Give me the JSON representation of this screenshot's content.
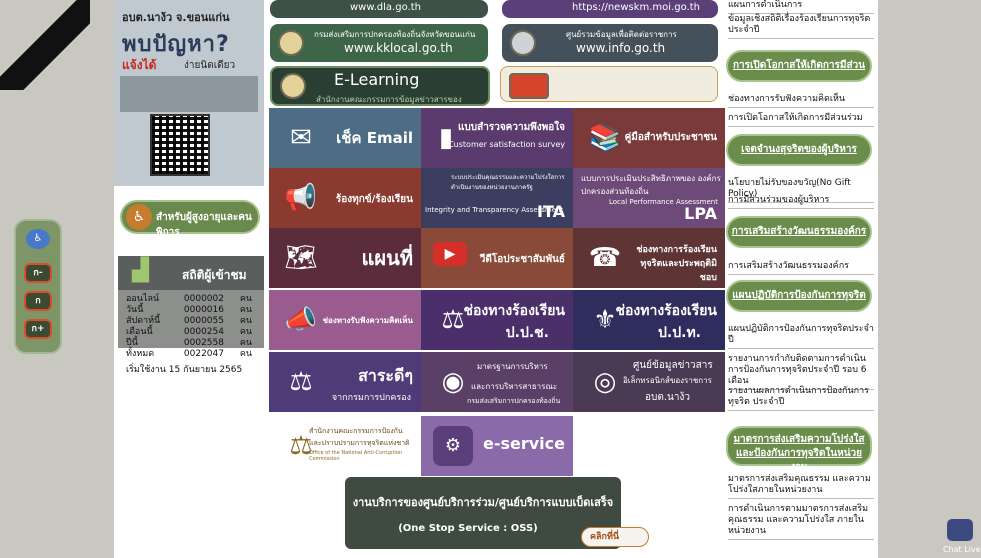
{
  "left_poster": {
    "org": "อบต.นาง้ว จ.ขอนแก่น",
    "headline": "พบปัญหา?",
    "sub_red": "แจ้งได้",
    "sub_dark": "ง่ายนิดเดียว"
  },
  "elderly_button": {
    "label": "สำหรับผู้สูงอายุและคนพิการ"
  },
  "stats": {
    "title": "สถิติผู้เข้าชม",
    "rows": [
      {
        "label": "ออนไลน์",
        "value": "0000002",
        "unit": "คน"
      },
      {
        "label": "วันนี้",
        "value": "0000016",
        "unit": "คน"
      },
      {
        "label": "สัปดาห์นี้",
        "value": "0000055",
        "unit": "คน"
      },
      {
        "label": "เดือนนี้",
        "value": "0000254",
        "unit": "คน"
      },
      {
        "label": "ปีนี้",
        "value": "0002558",
        "unit": "คน"
      },
      {
        "label": "ทั้งหมด",
        "value": "0022047",
        "unit": "คน"
      }
    ],
    "since": "เริ่มใช้งาน 15 กันยายน 2565"
  },
  "font_panel": {
    "minus": "ก-",
    "normal": "ก",
    "plus": "ก+"
  },
  "top_links": {
    "dla": "www.dla.go.th",
    "newskm": "https://newskm.moi.go.th",
    "kklocal_caption": "กรมส่งเสริมการปกครองท้องถิ่นจังหวัดขอนแก่น",
    "kklocal_url": "www.kklocal.go.th",
    "info_caption": "ศูนย์รวมข้อมูลเพื่อติดต่อราชการ",
    "info_url": "www.info.go.th",
    "elearning": "E-Learning",
    "elearning_sub": "สำนักงานคณะกรรมการข้อมูลข่าวสารของราชการ"
  },
  "tiles": {
    "check_email": "เช็ค Email",
    "survey": "แบบสำรวจความพึงพอใจ",
    "survey_en": "Customer satisfaction survey",
    "manual": "คู่มือสำหรับประชาชน",
    "complaint": "ร้องทุกข์/ร้องเรียน",
    "ita_small": "ระบบประเมินคุณธรรมและความโปร่งใสการดำเนินงานของหน่วยงานภาครัฐ",
    "ita_en": "Integrity and Transparency Assessment",
    "ita": "ITA",
    "lpa_th": "แบบการประเมินประสิทธิภาพของ องค์กรปกครองส่วนท้องถิ่น",
    "lpa_en": "Local Performance Assessment",
    "lpa": "LPA",
    "map": "แผนที่",
    "video": "วีดีโอประชาสัมพันธ์",
    "corruption_channel": "ช่องทางการร้องเรียนทุจริตและประพฤติมิชอบ",
    "opinion": "ช่องทางรับฟังความคิดเห็น",
    "ppch_title": "ช่องทางร้องเรียน",
    "ppch": "ป.ป.ช.",
    "ppt_title": "ช่องทางร้องเรียน",
    "ppt": "ป.ป.ท.",
    "sarakadee": "สาระดีๆ",
    "sarakadee_sub": "จากกรมการปกครอง",
    "standard_1": "มาตรฐานการบริหาร",
    "standard_2": "และการบริหารสาธารณะ",
    "standard_3": "กรมส่งเสริมการปกครองท้องถิ่น",
    "info_center_1": "ศูนย์ข้อมูลข่าวสาร",
    "info_center_2": "อิเล็กทรอนิกส์ของราชการ",
    "info_center_3": "อบต.นาง้ว",
    "nacc_1": "สำนักงานคณะกรรมการป้องกัน",
    "nacc_2": "และปราบปรามการทุจริตแห่งชาติ",
    "nacc_en": "Office of the National Anti-Corruption Commission",
    "eservice": "e-service"
  },
  "oss": {
    "title": "งานบริการของศูนย์บริการร่วม/ศูนย์บริการแบบเบ็ดเสร็จ",
    "subtitle": "(One Stop Service : OSS)",
    "click": "คลิกที่นี่"
  },
  "right_col": {
    "top_cut": "แผนการดำเนินการ",
    "link_stats": "ข้อมูลเชิงสถิติเรื่องร้องเรียนการทุจริตประจำปี",
    "btn_participation": "การเปิดโอกาสให้เกิดการมีส่วนร่วม",
    "link_channel": "ช่องทางการรับฟังความคิดเห็น",
    "link_participation": "การเปิดโอกาสให้เกิดการมีส่วนร่วม",
    "btn_integrity": "เจตจำนงสุจริตของผู้บริหาร",
    "link_nogift": "นโยบายไม่รับของขวัญ(No Gift Policy)",
    "link_exec": "การมีส่วนร่วมของผู้บริหาร",
    "btn_culture": "การเสริมสร้างวัฒนธรรมองค์กร",
    "link_culture": "การเสริมสร้างวัฒนธรรมองค์กร",
    "btn_prevent": "แผนปฏิบัติการป้องกันการทุจริต",
    "link_prevent": "แผนปฏิบัติการป้องกันการทุจริตประจำปี",
    "link_report": "รายงานการกำกับติดตามการดำเนินการป้องกันการทุจริตประจำปี รอบ 6 เดือน",
    "link_result": "รายงานผลการดำเนินการป้องกันการทุจริต ประจำปี",
    "btn_measures": "มาตรการส่งเสริมความโปร่งใสและป้องกันการทุจริตในหน่วยงาน",
    "link_measures": "มาตรการส่งเสริมคุณธรรม และความโปร่งใสภายในหน่วยงาน",
    "link_follow": "การดำเนินการตามมาตรการส่งเสริมคุณธรรม และความโปร่งใส ภายในหน่วยงาน"
  },
  "chat": {
    "label": "Chat Live"
  }
}
